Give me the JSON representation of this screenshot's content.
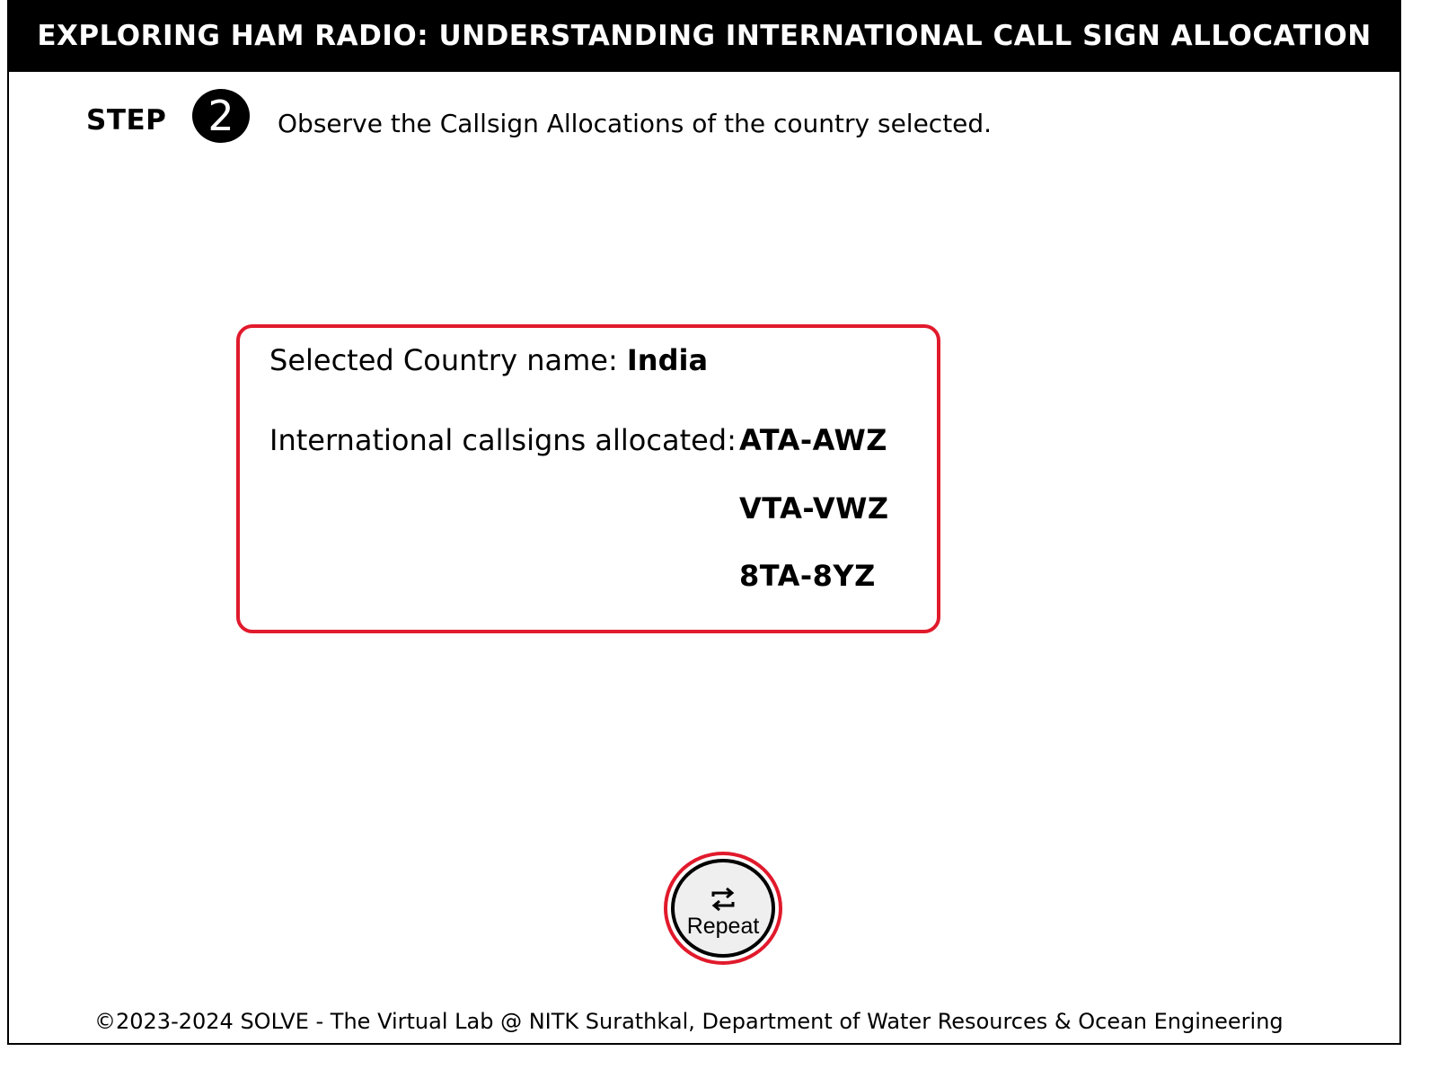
{
  "header": {
    "title": "EXPLORING HAM RADIO: UNDERSTANDING INTERNATIONAL CALL SIGN ALLOCATION"
  },
  "step": {
    "label": "STEP",
    "number": "2",
    "instruction": "Observe the Callsign Allocations of the country selected."
  },
  "info": {
    "country_label": "Selected Country name:",
    "country_value": "India",
    "callsigns_label": "International callsigns allocated:",
    "callsigns": [
      "ATA-AWZ",
      "VTA-VWZ",
      "8TA-8YZ"
    ]
  },
  "controls": {
    "repeat_label": "Repeat",
    "repeat_icon": "repeat-icon"
  },
  "footer": {
    "text": "©2023-2024 SOLVE - The Virtual Lab @ NITK Surathkal, Department of Water Resources & Ocean Engineering"
  },
  "colors": {
    "title_bg": "#000000",
    "title_fg": "#ffffff",
    "accent_border": "#e11a2c",
    "button_bg": "#efefef"
  }
}
